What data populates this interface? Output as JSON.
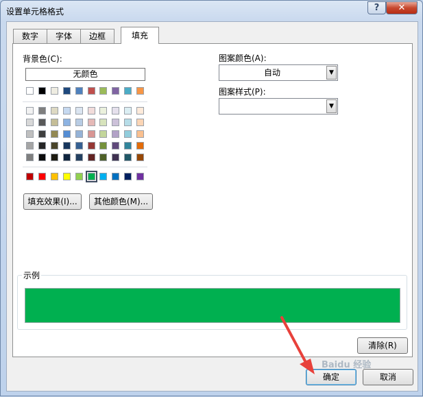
{
  "window": {
    "title": "设置单元格格式"
  },
  "titlebar": {
    "help_label": "?",
    "close_label": "✕"
  },
  "tabs": [
    {
      "label": "数字"
    },
    {
      "label": "字体"
    },
    {
      "label": "边框"
    },
    {
      "label": "填充"
    }
  ],
  "fill": {
    "background_label": "背景色(C):",
    "no_color_label": "无颜色",
    "theme_top_row": [
      "#ffffff",
      "#000000",
      "#eeece1",
      "#1f497d",
      "#4f81bd",
      "#c0504d",
      "#9bbb59",
      "#8064a2",
      "#4bacc6",
      "#f79646"
    ],
    "theme_shades": [
      [
        "#f2f2f2",
        "#7f7f7f",
        "#ddd9c3",
        "#c6d9f0",
        "#dbe5f1",
        "#f2dcdb",
        "#ebf1dd",
        "#e5e0ec",
        "#dbeef3",
        "#fdeada"
      ],
      [
        "#d8d8d8",
        "#595959",
        "#c4bd97",
        "#8db3e2",
        "#b8cce4",
        "#e5b9b7",
        "#d7e3bc",
        "#ccc1d9",
        "#b7dde8",
        "#fbd5b5"
      ],
      [
        "#bfbfbf",
        "#3f3f3f",
        "#938953",
        "#548dd4",
        "#95b3d7",
        "#d99694",
        "#c3d69b",
        "#b2a2c7",
        "#92cddc",
        "#fac08f"
      ],
      [
        "#a5a5a5",
        "#262626",
        "#494429",
        "#17365d",
        "#366092",
        "#953734",
        "#76923c",
        "#5f497a",
        "#31859b",
        "#e36c09"
      ],
      [
        "#7f7f7f",
        "#0c0c0c",
        "#1d1b10",
        "#0f243e",
        "#244061",
        "#632423",
        "#4f6128",
        "#3f3151",
        "#205867",
        "#974806"
      ]
    ],
    "standard_colors": [
      "#c00000",
      "#ff0000",
      "#ffc000",
      "#ffff00",
      "#92d050",
      "#00b050",
      "#00b0f0",
      "#0070c0",
      "#002060",
      "#7030a0"
    ],
    "selected_standard_index": 5,
    "fill_effects_label": "填充效果(I)...",
    "more_colors_label": "其他颜色(M)...",
    "pattern_color_label": "图案颜色(A):",
    "pattern_color_value": "自动",
    "pattern_style_label": "图案样式(P):",
    "pattern_style_value": "",
    "sample_label": "示例",
    "sample_color": "#00b050",
    "clear_label": "清除(R)"
  },
  "footer": {
    "ok_label": "确定",
    "cancel_label": "取消"
  },
  "watermark": "Baidu 经验"
}
